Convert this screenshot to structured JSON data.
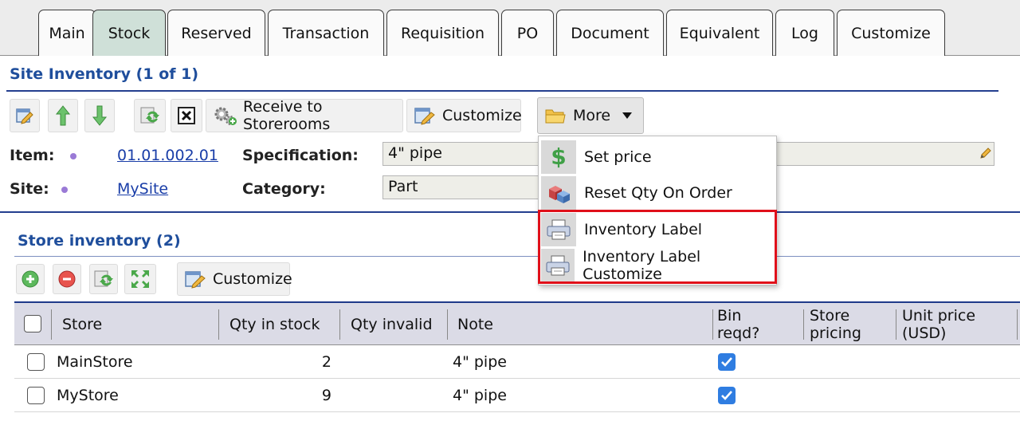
{
  "tabs": [
    "Main",
    "Stock",
    "Reserved",
    "Transaction",
    "Requisition",
    "PO",
    "Document",
    "Equivalent",
    "Log",
    "Customize"
  ],
  "active_tab": "Stock",
  "site_inventory": {
    "title": "Site Inventory (1 of 1)",
    "toolbar": {
      "receive_label": "Receive to Storerooms",
      "customize_label": "Customize",
      "more_label": "More"
    },
    "fields": {
      "item_label": "Item:",
      "item_value": "01.01.002.01",
      "site_label": "Site:",
      "site_value": "MySite",
      "spec_label": "Specification:",
      "spec_value": "4\" pipe",
      "category_label": "Category:",
      "category_value": "Part"
    }
  },
  "more_menu": {
    "items": [
      {
        "label": "Set price",
        "icon": "dollar-icon"
      },
      {
        "label": "Reset Qty On Order",
        "icon": "cubes-icon"
      },
      {
        "label": "Inventory Label",
        "icon": "printer-icon"
      },
      {
        "label": "Inventory Label Customize",
        "icon": "printer-icon"
      }
    ],
    "highlight_color": "#e0101a"
  },
  "store_inventory": {
    "title": "Store inventory (2)",
    "customize_label": "Customize",
    "columns": {
      "store": "Store",
      "qty_in_stock": "Qty in stock",
      "qty_invalid": "Qty invalid",
      "note": "Note",
      "bin_reqd_1": "Bin",
      "bin_reqd_2": "reqd?",
      "store_pricing_1": "Store",
      "store_pricing_2": "pricing",
      "unit_price_1": "Unit price",
      "unit_price_2": "(USD)"
    },
    "rows": [
      {
        "store": "MainStore",
        "qty_in_stock": "2",
        "qty_invalid": "",
        "note": "4\" pipe",
        "bin_reqd": true
      },
      {
        "store": "MyStore",
        "qty_in_stock": "9",
        "qty_invalid": "",
        "note": "4\" pipe",
        "bin_reqd": true
      }
    ]
  },
  "colors": {
    "section_title": "#1f4e9c",
    "active_tab_bg": "#cfe0d8",
    "checkbox_checked": "#2f7de1"
  }
}
